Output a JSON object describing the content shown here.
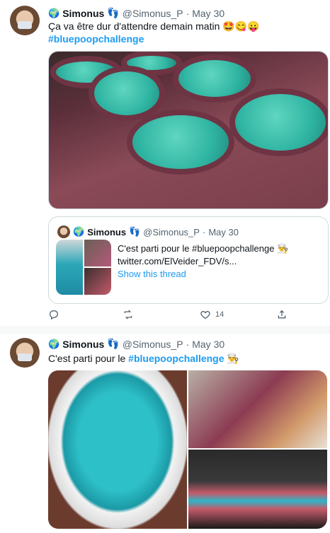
{
  "tweet1": {
    "display_name": "Simonus",
    "handle": "@Simonus_P",
    "date": "May 30",
    "globe_emoji": "🌍",
    "feet_emoji": "👣",
    "text": "Ça va être dur d'attendre demain matin 🤩😋😛",
    "hashtag": "#bluepoopchallenge",
    "quote": {
      "display_name": "Simonus",
      "handle": "@Simonus_P",
      "date": "May 30",
      "text": "C'est parti pour le #bluepoopchallenge 👨‍🍳",
      "link": "twitter.com/ElVeider_FDV/s...",
      "show_thread": "Show this thread"
    },
    "likes": "14"
  },
  "tweet2": {
    "display_name": "Simonus",
    "handle": "@Simonus_P",
    "date": "May 30",
    "text_prefix": "C'est parti pour le ",
    "hashtag": "#bluepoopchallenge",
    "emoji": "👨‍🍳"
  },
  "icons": {
    "reply": "reply-icon",
    "retweet": "retweet-icon",
    "like": "heart-icon",
    "share": "share-icon"
  },
  "colors": {
    "accent": "#1d9bf0",
    "muted": "#536471",
    "dough": "#2fb4a2"
  }
}
